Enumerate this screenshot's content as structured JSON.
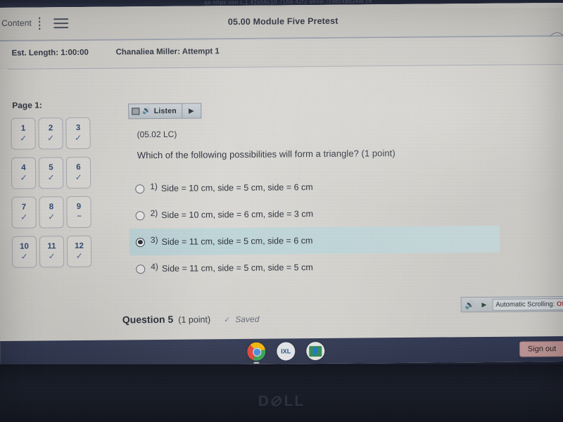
{
  "browser": {
    "url_fragment": "qa  nttps  con c.1  42a56c10-716d-42f2-9e59-7c9bc4ab34af.ce"
  },
  "topbar": {
    "content_label": "Content",
    "kebab_icon": "vertical-dots-icon",
    "hamburger_icon": "hamburger-menu-icon",
    "quiz_title": "05.00 Module Five Pretest",
    "collapse_icon": "chevron-left-icon"
  },
  "subheader": {
    "est_length": "Est. Length: 1:00:00",
    "attempt": "Chanaliea Miller: Attempt 1"
  },
  "pagenav": {
    "label": "Page 1:",
    "items": [
      {
        "number": "1",
        "mark": "✓",
        "state": "answered"
      },
      {
        "number": "2",
        "mark": "✓",
        "state": "answered"
      },
      {
        "number": "3",
        "mark": "✓",
        "state": "answered"
      },
      {
        "number": "4",
        "mark": "✓",
        "state": "answered"
      },
      {
        "number": "5",
        "mark": "✓",
        "state": "answered"
      },
      {
        "number": "6",
        "mark": "✓",
        "state": "answered"
      },
      {
        "number": "7",
        "mark": "✓",
        "state": "answered"
      },
      {
        "number": "8",
        "mark": "✓",
        "state": "answered"
      },
      {
        "number": "9",
        "mark": "--",
        "state": "unanswered"
      },
      {
        "number": "10",
        "mark": "✓",
        "state": "answered"
      },
      {
        "number": "11",
        "mark": "✓",
        "state": "answered"
      },
      {
        "number": "12",
        "mark": "✓",
        "state": "answered"
      }
    ]
  },
  "listen_toolbar": {
    "stop_icon": "stop-square-icon",
    "speaker_icon": "speaker-icon",
    "label": "Listen",
    "play_icon": "play-triangle-icon"
  },
  "question": {
    "code": "(05.02 LC)",
    "text": "Which of the following possibilities will form a triangle? (1 point)",
    "options": [
      {
        "number": "1)",
        "text": "Side = 10 cm, side = 5 cm, side = 6 cm",
        "selected": false
      },
      {
        "number": "2)",
        "text": "Side = 10 cm, side = 6 cm, side = 3 cm",
        "selected": false
      },
      {
        "number": "3)",
        "text": "Side = 11 cm, side = 5 cm, side = 6 cm",
        "selected": true
      },
      {
        "number": "4)",
        "text": "Side = 11 cm, side = 5 cm, side = 5 cm",
        "selected": false
      }
    ],
    "footer": {
      "label": "Question 5",
      "points": "(1 point)",
      "saved_check": "✓",
      "saved_text": "Saved"
    }
  },
  "autoscroll": {
    "speaker_icon": "speaker-icon",
    "play_icon": "play-triangle-icon",
    "label": "Automatic Scrolling:",
    "value": "Off",
    "value_color": "#b03a3a"
  },
  "taskbar": {
    "icons": [
      {
        "name": "chrome-icon",
        "label": ""
      },
      {
        "name": "blue-app-icon",
        "label": "IXL"
      },
      {
        "name": "classroom-icon",
        "label": "●"
      }
    ],
    "signout_label": "Sign out"
  },
  "bezel": {
    "brand": "D",
    "brand_o": "⊘",
    "brand_rest": "LL"
  },
  "colors": {
    "selected_option_bg": "#c3dade",
    "accent_number": "#2c4673",
    "signout_bg": "#c79a9b",
    "taskbar_bg": "#2f3753"
  }
}
